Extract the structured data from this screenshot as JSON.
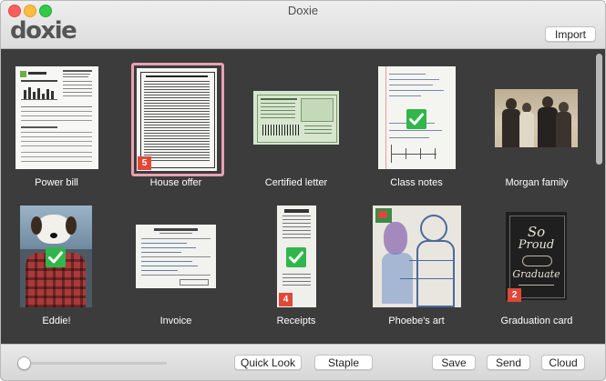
{
  "window": {
    "title": "Doxie"
  },
  "header": {
    "logo_text": "doxie",
    "import_label": "Import"
  },
  "items": [
    {
      "caption": "Power bill",
      "badge": "",
      "checked": false
    },
    {
      "caption": "House offer",
      "badge": "5",
      "checked": false,
      "selected": true
    },
    {
      "caption": "Certified letter",
      "badge": "",
      "checked": false
    },
    {
      "caption": "Class notes",
      "badge": "",
      "checked": true
    },
    {
      "caption": "Morgan family",
      "badge": "",
      "checked": false
    },
    {
      "caption": "Eddie!",
      "badge": "",
      "checked": true
    },
    {
      "caption": "Invoice",
      "badge": "",
      "checked": false
    },
    {
      "caption": "Receipts",
      "badge": "4",
      "checked": true
    },
    {
      "caption": "Phoebe's art",
      "badge": "",
      "checked": false
    },
    {
      "caption": "Graduation card",
      "badge": "2",
      "checked": false
    }
  ],
  "toolbar": {
    "quick_look_label": "Quick Look",
    "staple_label": "Staple",
    "save_label": "Save",
    "send_label": "Send",
    "cloud_label": "Cloud",
    "zoom_level": 0
  },
  "colors": {
    "selection": "#e8a1b3",
    "check": "#31b64b",
    "badge": "#e0483a"
  }
}
